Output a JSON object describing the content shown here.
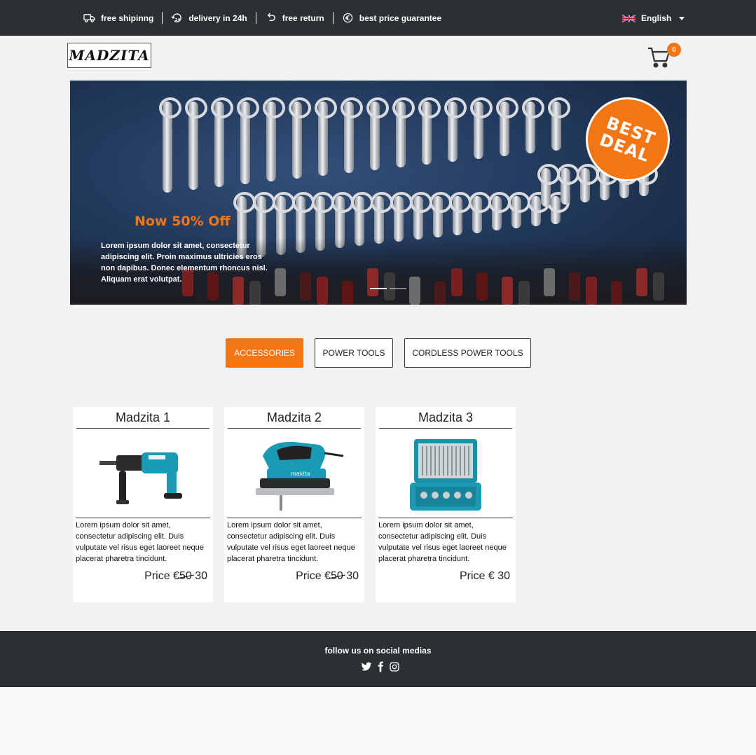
{
  "topbar": {
    "perks": [
      {
        "icon": "truck-icon",
        "label": "free shipinng"
      },
      {
        "icon": "delivery-24h-icon",
        "label": "delivery in 24h"
      },
      {
        "icon": "return-arrow-icon",
        "label": "free return"
      },
      {
        "icon": "euro-icon",
        "label": "best price guarantee"
      }
    ],
    "language": "English",
    "language_flag": "uk-flag-icon"
  },
  "header": {
    "logo": "MADZITA",
    "cart_count": "0"
  },
  "hero": {
    "title": "Now 50% Off",
    "text": "Lorem ipsum dolor sit amet, consectetur adipiscing elit. Proin maximus ultricies eros non dapibus. Donec elementum rhoncus nisl. Aliquam erat volutpat.",
    "badge_line1": "BEST",
    "badge_line2": "DEAL",
    "slides": 2,
    "active_slide": 1
  },
  "tabs": [
    {
      "label": "ACCESSORIES",
      "active": true
    },
    {
      "label": "POWER TOOLS",
      "active": false
    },
    {
      "label": "CORDLESS POWER TOOLS",
      "active": false
    }
  ],
  "products": [
    {
      "title": "Madzita 1",
      "description": "Lorem ipsum dolor sit amet, consectetur adipiscing elit. Duis vulputate vel risus eget laoreet neque placerat pharetra tincidunt.",
      "price_label": "Price",
      "currency": "€",
      "old_price": "50",
      "price": "30",
      "image": "rotary-hammer-drill"
    },
    {
      "title": "Madzita 2",
      "description": "Lorem ipsum dolor sit amet, consectetur adipiscing elit. Duis vulputate vel risus eget laoreet neque placerat pharetra tincidunt.",
      "price_label": "Price",
      "currency": "€",
      "old_price": "50",
      "price": "30",
      "image": "jigsaw"
    },
    {
      "title": "Madzita 3",
      "description": "Lorem ipsum dolor sit amet, consectetur adipiscing elit. Duis vulputate vel risus eget laoreet neque placerat pharetra tincidunt.",
      "price_label": "Price",
      "currency": "€",
      "old_price": "",
      "price": "30",
      "image": "accessory-case"
    }
  ],
  "footer": {
    "text": "follow us on social medias",
    "socials": [
      "twitter-icon",
      "facebook-icon",
      "instagram-icon"
    ]
  },
  "colors": {
    "accent": "#f47514",
    "dark": "#2b3133",
    "background": "#f2f2f2"
  }
}
